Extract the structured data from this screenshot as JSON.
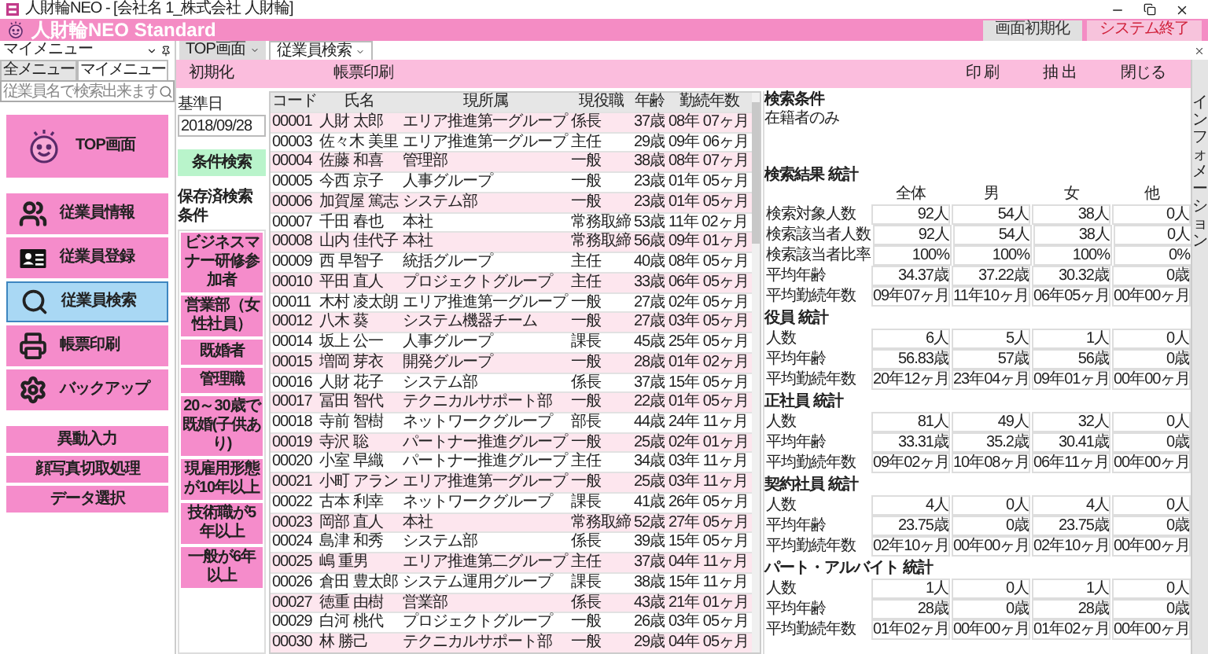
{
  "window": {
    "title": "人財輪NEO - [会社名 1_株式会社 人財輪]"
  },
  "header": {
    "app_name": "人財輪NEO Standard",
    "buttons": [
      {
        "label": "画面初期化",
        "kind": "normal"
      },
      {
        "label": "システム終了",
        "kind": "danger"
      }
    ]
  },
  "menu_panel": {
    "title": "マイメニュー",
    "tabs": [
      {
        "label": "全メニュー",
        "selected": false
      },
      {
        "label": "マイメニュー",
        "selected": true
      }
    ],
    "search": {
      "placeholder": "従業員名で検索出来ます"
    },
    "items": [
      {
        "label": "TOP画面",
        "kind": "large",
        "selected": false
      },
      {
        "label": "従業員情報",
        "kind": "icon",
        "selected": false
      },
      {
        "label": "従業員登録",
        "kind": "icon",
        "selected": false
      },
      {
        "label": "従業員検索",
        "kind": "icon",
        "selected": true
      },
      {
        "label": "帳票印刷",
        "kind": "icon",
        "selected": false
      },
      {
        "label": "バックアップ",
        "kind": "icon",
        "selected": false
      },
      {
        "label": "異動入力",
        "kind": "text",
        "selected": false
      },
      {
        "label": "顔写真切取処理",
        "kind": "text",
        "selected": false
      },
      {
        "label": "データ選択",
        "kind": "text",
        "selected": false
      }
    ]
  },
  "doc_tabs": [
    {
      "label": "TOP画面",
      "selected": false
    },
    {
      "label": "従業員検索",
      "selected": true
    }
  ],
  "toolbar": {
    "left": [
      "初期化",
      "帳票印刷"
    ],
    "right": [
      "印 刷",
      "抽 出",
      "閉じる"
    ]
  },
  "side_strip": "インフォメーション",
  "search_form": {
    "date_label": "基準日",
    "date_value": "2018/09/28",
    "search_button": "条件検索",
    "saved_title": "保存済検索条件",
    "saved": [
      "ビジネスマナー研修参加者",
      "営業部（女性社員）",
      "既婚者",
      "管理職",
      "20～30歳で既婚(子供あり)",
      "現雇用形態が10年以上",
      "技術職が5年以上",
      "一般が6年以上"
    ]
  },
  "table": {
    "columns": [
      "コード",
      "氏名",
      "現所属",
      "現役職",
      "年齢",
      "勤続年数"
    ],
    "rows": [
      [
        "00001",
        "人財 太郎",
        "エリア推進第一グループ",
        "係長",
        "37歳",
        "08年 07ヶ月"
      ],
      [
        "00003",
        "佐々木 美里",
        "エリア推進第一グループ",
        "主任",
        "29歳",
        "09年 06ヶ月"
      ],
      [
        "00004",
        "佐藤 和喜",
        "管理部",
        "一般",
        "38歳",
        "08年 07ヶ月"
      ],
      [
        "00005",
        "今西 京子",
        "人事グループ",
        "一般",
        "23歳",
        "01年 05ヶ月"
      ],
      [
        "00006",
        "加賀屋 篤志",
        "システム部",
        "一般",
        "23歳",
        "01年 05ヶ月"
      ],
      [
        "00007",
        "千田 春也",
        "本社",
        "常務取締",
        "53歳",
        "11年 02ヶ月"
      ],
      [
        "00008",
        "山内 佳代子",
        "本社",
        "常務取締",
        "56歳",
        "09年 01ヶ月"
      ],
      [
        "00009",
        "西 早智子",
        "統括グループ",
        "主任",
        "40歳",
        "08年 05ヶ月"
      ],
      [
        "00010",
        "平田 直人",
        "プロジェクトグループ",
        "主任",
        "33歳",
        "06年 05ヶ月"
      ],
      [
        "00011",
        "木村 凌太朗",
        "エリア推進第一グループ",
        "一般",
        "27歳",
        "02年 05ヶ月"
      ],
      [
        "00012",
        "八木 葵",
        "システム機器チーム",
        "一般",
        "27歳",
        "03年 05ヶ月"
      ],
      [
        "00014",
        "坂上 公一",
        "人事グループ",
        "課長",
        "45歳",
        "25年 05ヶ月"
      ],
      [
        "00015",
        "増岡 芽衣",
        "開発グループ",
        "一般",
        "28歳",
        "01年 02ヶ月"
      ],
      [
        "00016",
        "人財 花子",
        "システム部",
        "係長",
        "37歳",
        "15年 05ヶ月"
      ],
      [
        "00017",
        "冨田 智代",
        "テクニカルサポート部",
        "一般",
        "22歳",
        "01年 05ヶ月"
      ],
      [
        "00018",
        "寺前 智樹",
        "ネットワークグループ",
        "部長",
        "44歳",
        "24年 11ヶ月"
      ],
      [
        "00019",
        "寺沢 聡",
        "パートナー推進グループ",
        "一般",
        "25歳",
        "02年 01ヶ月"
      ],
      [
        "00020",
        "小室 早織",
        "パートナー推進グループ",
        "主任",
        "34歳",
        "03年 11ヶ月"
      ],
      [
        "00021",
        "小町 アラン",
        "エリア推進第一グループ",
        "一般",
        "25歳",
        "03年 11ヶ月"
      ],
      [
        "00022",
        "古本 利幸",
        "ネットワークグループ",
        "課長",
        "41歳",
        "26年 05ヶ月"
      ],
      [
        "00023",
        "岡部 直人",
        "本社",
        "常務取締",
        "52歳",
        "27年 05ヶ月"
      ],
      [
        "00024",
        "島津 和秀",
        "システム部",
        "係長",
        "39歳",
        "15年 05ヶ月"
      ],
      [
        "00025",
        "嶋 重男",
        "エリア推進第二グループ",
        "主任",
        "37歳",
        "04年 11ヶ月"
      ],
      [
        "00026",
        "倉田 豊太郎",
        "システム運用グループ",
        "課長",
        "38歳",
        "15年 11ヶ月"
      ],
      [
        "00027",
        "徳重 由樹",
        "営業部",
        "係長",
        "43歳",
        "21年 01ヶ月"
      ],
      [
        "00029",
        "白河 桃代",
        "プロジェクトグループ",
        "一般",
        "26歳",
        "03年 05ヶ月"
      ],
      [
        "00030",
        "林 勝己",
        "テクニカルサポート部",
        "一般",
        "29歳",
        "04年 05ヶ月"
      ]
    ]
  },
  "stats": {
    "condition_title": "検索条件",
    "condition_text": "在籍者のみ",
    "sections": [
      {
        "title": "検索結果 統計",
        "columns": [
          "全体",
          "男",
          "女",
          "他"
        ],
        "rows": [
          {
            "label": "検索対象人数",
            "values": [
              "92人",
              "54人",
              "38人",
              "0人"
            ]
          },
          {
            "label": "検索該当者人数",
            "values": [
              "92人",
              "54人",
              "38人",
              "0人"
            ]
          },
          {
            "label": "検索該当者比率",
            "values": [
              "100%",
              "100%",
              "100%",
              "0%"
            ]
          },
          {
            "label": "平均年齢",
            "values": [
              "34.37歳",
              "37.22歳",
              "30.32歳",
              "0歳"
            ]
          },
          {
            "label": "平均勤続年数",
            "values": [
              "09年07ヶ月",
              "11年10ヶ月",
              "06年05ヶ月",
              "00年00ヶ月"
            ]
          }
        ]
      },
      {
        "title": "役員 統計",
        "rows": [
          {
            "label": "人数",
            "values": [
              "6人",
              "5人",
              "1人",
              "0人"
            ]
          },
          {
            "label": "平均年齢",
            "values": [
              "56.83歳",
              "57歳",
              "56歳",
              "0歳"
            ]
          },
          {
            "label": "平均勤続年数",
            "values": [
              "20年12ヶ月",
              "23年04ヶ月",
              "09年01ヶ月",
              "00年00ヶ月"
            ]
          }
        ]
      },
      {
        "title": "正社員 統計",
        "rows": [
          {
            "label": "人数",
            "values": [
              "81人",
              "49人",
              "32人",
              "0人"
            ]
          },
          {
            "label": "平均年齢",
            "values": [
              "33.31歳",
              "35.2歳",
              "30.41歳",
              "0歳"
            ]
          },
          {
            "label": "平均勤続年数",
            "values": [
              "09年02ヶ月",
              "10年08ヶ月",
              "06年11ヶ月",
              "00年00ヶ月"
            ]
          }
        ]
      },
      {
        "title": "契約社員 統計",
        "rows": [
          {
            "label": "人数",
            "values": [
              "4人",
              "0人",
              "4人",
              "0人"
            ]
          },
          {
            "label": "平均年齢",
            "values": [
              "23.75歳",
              "0歳",
              "23.75歳",
              "0歳"
            ]
          },
          {
            "label": "平均勤続年数",
            "values": [
              "02年10ヶ月",
              "00年00ヶ月",
              "02年10ヶ月",
              "00年00ヶ月"
            ]
          }
        ]
      },
      {
        "title": "パート・アルバイト 統計",
        "rows": [
          {
            "label": "人数",
            "values": [
              "1人",
              "0人",
              "1人",
              "0人"
            ]
          },
          {
            "label": "平均年齢",
            "values": [
              "28歳",
              "0歳",
              "28歳",
              "0歳"
            ]
          },
          {
            "label": "平均勤続年数",
            "values": [
              "01年02ヶ月",
              "00年00ヶ月",
              "01年02ヶ月",
              "00年00ヶ月"
            ]
          }
        ]
      }
    ]
  }
}
